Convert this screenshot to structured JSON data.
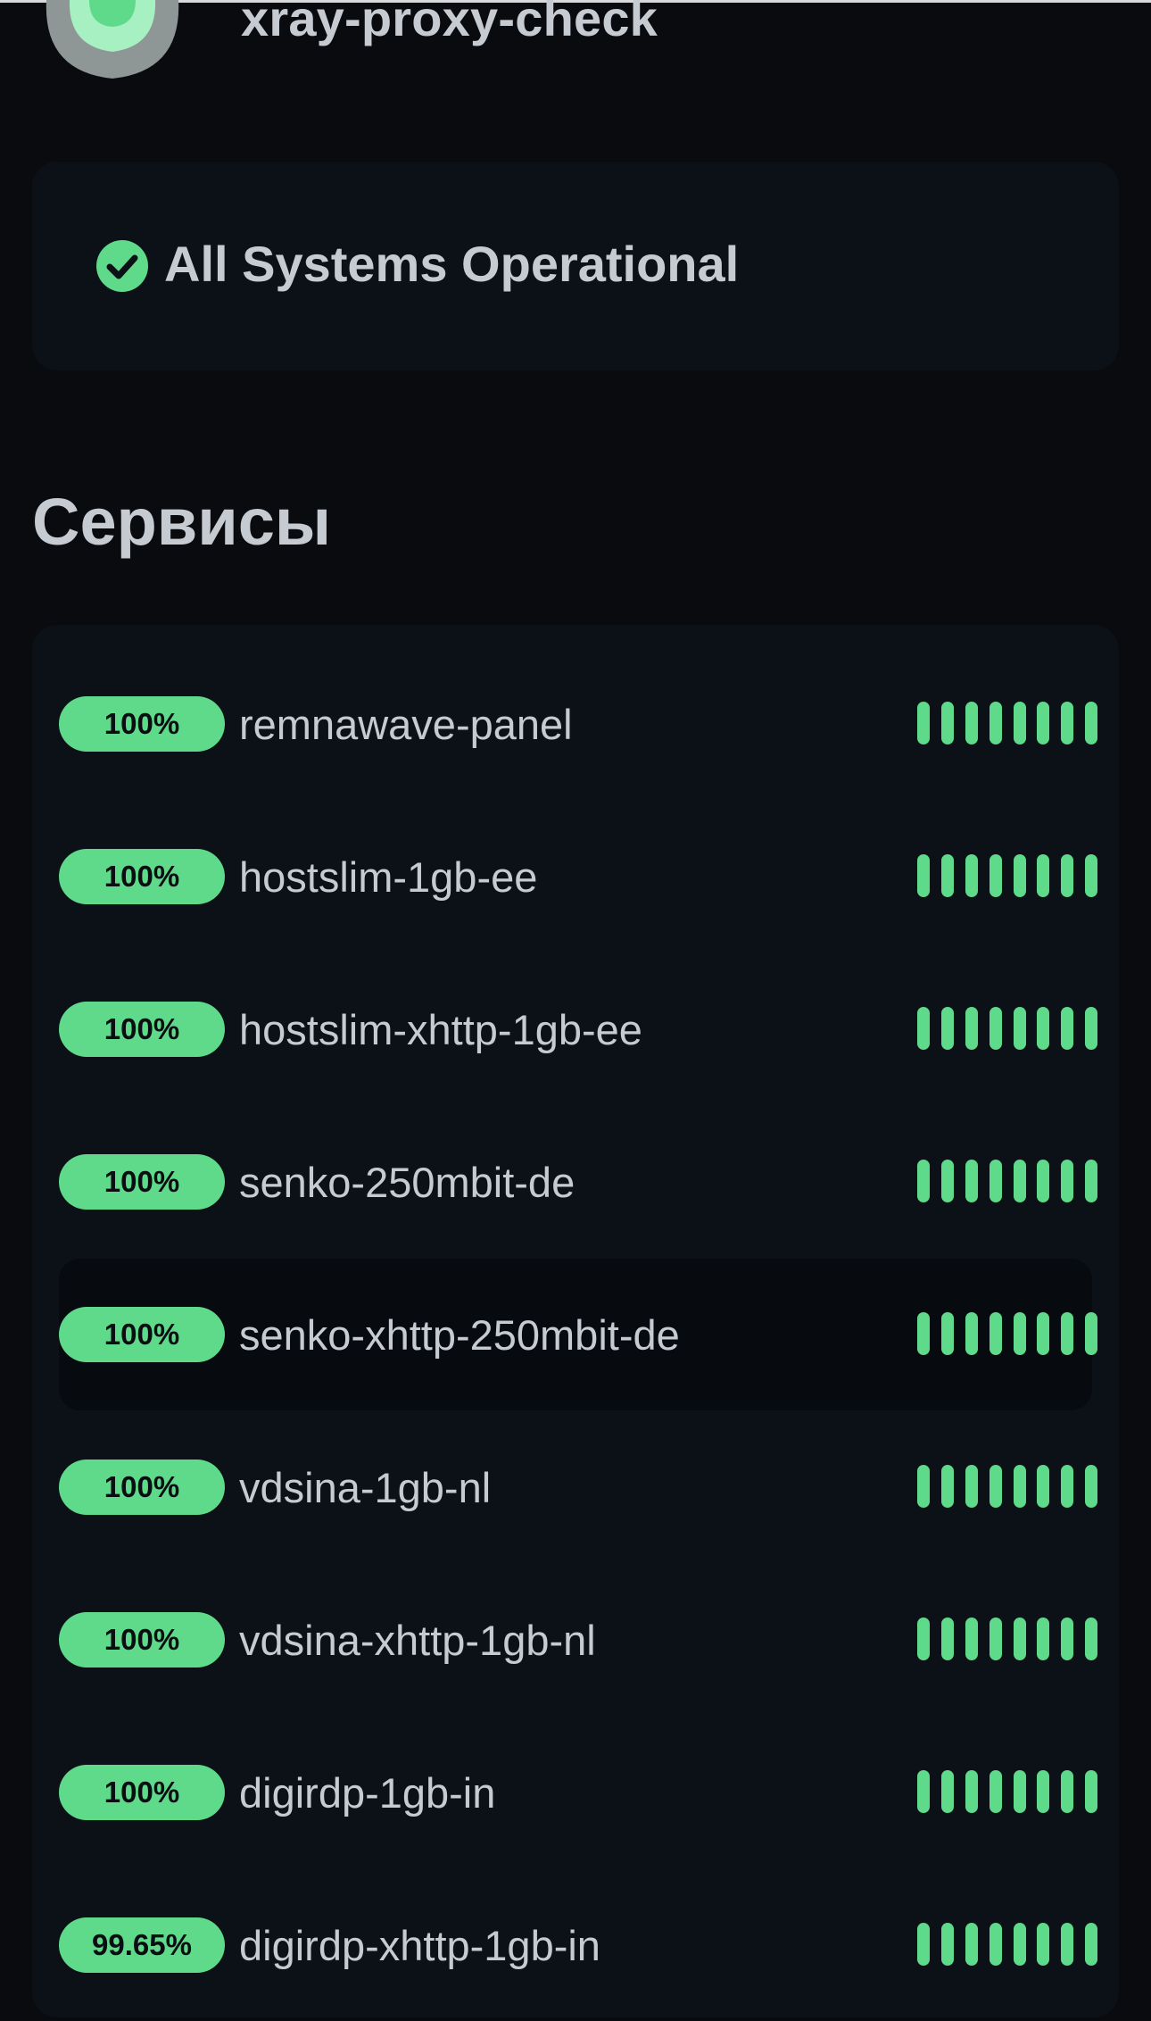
{
  "header": {
    "title": "xray-proxy-check",
    "logo_icon": "app-logo-icon"
  },
  "status": {
    "icon": "check-circle-icon",
    "text": "All Systems Operational",
    "color": "#5fd98a"
  },
  "section": {
    "title": "Сервисы"
  },
  "colors": {
    "background": "#090b0f",
    "card": "#0c1017",
    "accent_green": "#5fd98a"
  },
  "services": [
    {
      "uptime": "100%",
      "name": "remnawave-panel",
      "beats": 8
    },
    {
      "uptime": "100%",
      "name": "hostslim-1gb-ee",
      "beats": 8
    },
    {
      "uptime": "100%",
      "name": "hostslim-xhttp-1gb-ee",
      "beats": 8
    },
    {
      "uptime": "100%",
      "name": "senko-250mbit-de",
      "beats": 8
    },
    {
      "uptime": "100%",
      "name": "senko-xhttp-250mbit-de",
      "beats": 8
    },
    {
      "uptime": "100%",
      "name": "vdsina-1gb-nl",
      "beats": 8
    },
    {
      "uptime": "100%",
      "name": "vdsina-xhttp-1gb-nl",
      "beats": 8
    },
    {
      "uptime": "100%",
      "name": "digirdp-1gb-in",
      "beats": 8
    },
    {
      "uptime": "99.65%",
      "name": "digirdp-xhttp-1gb-in",
      "beats": 8
    }
  ]
}
